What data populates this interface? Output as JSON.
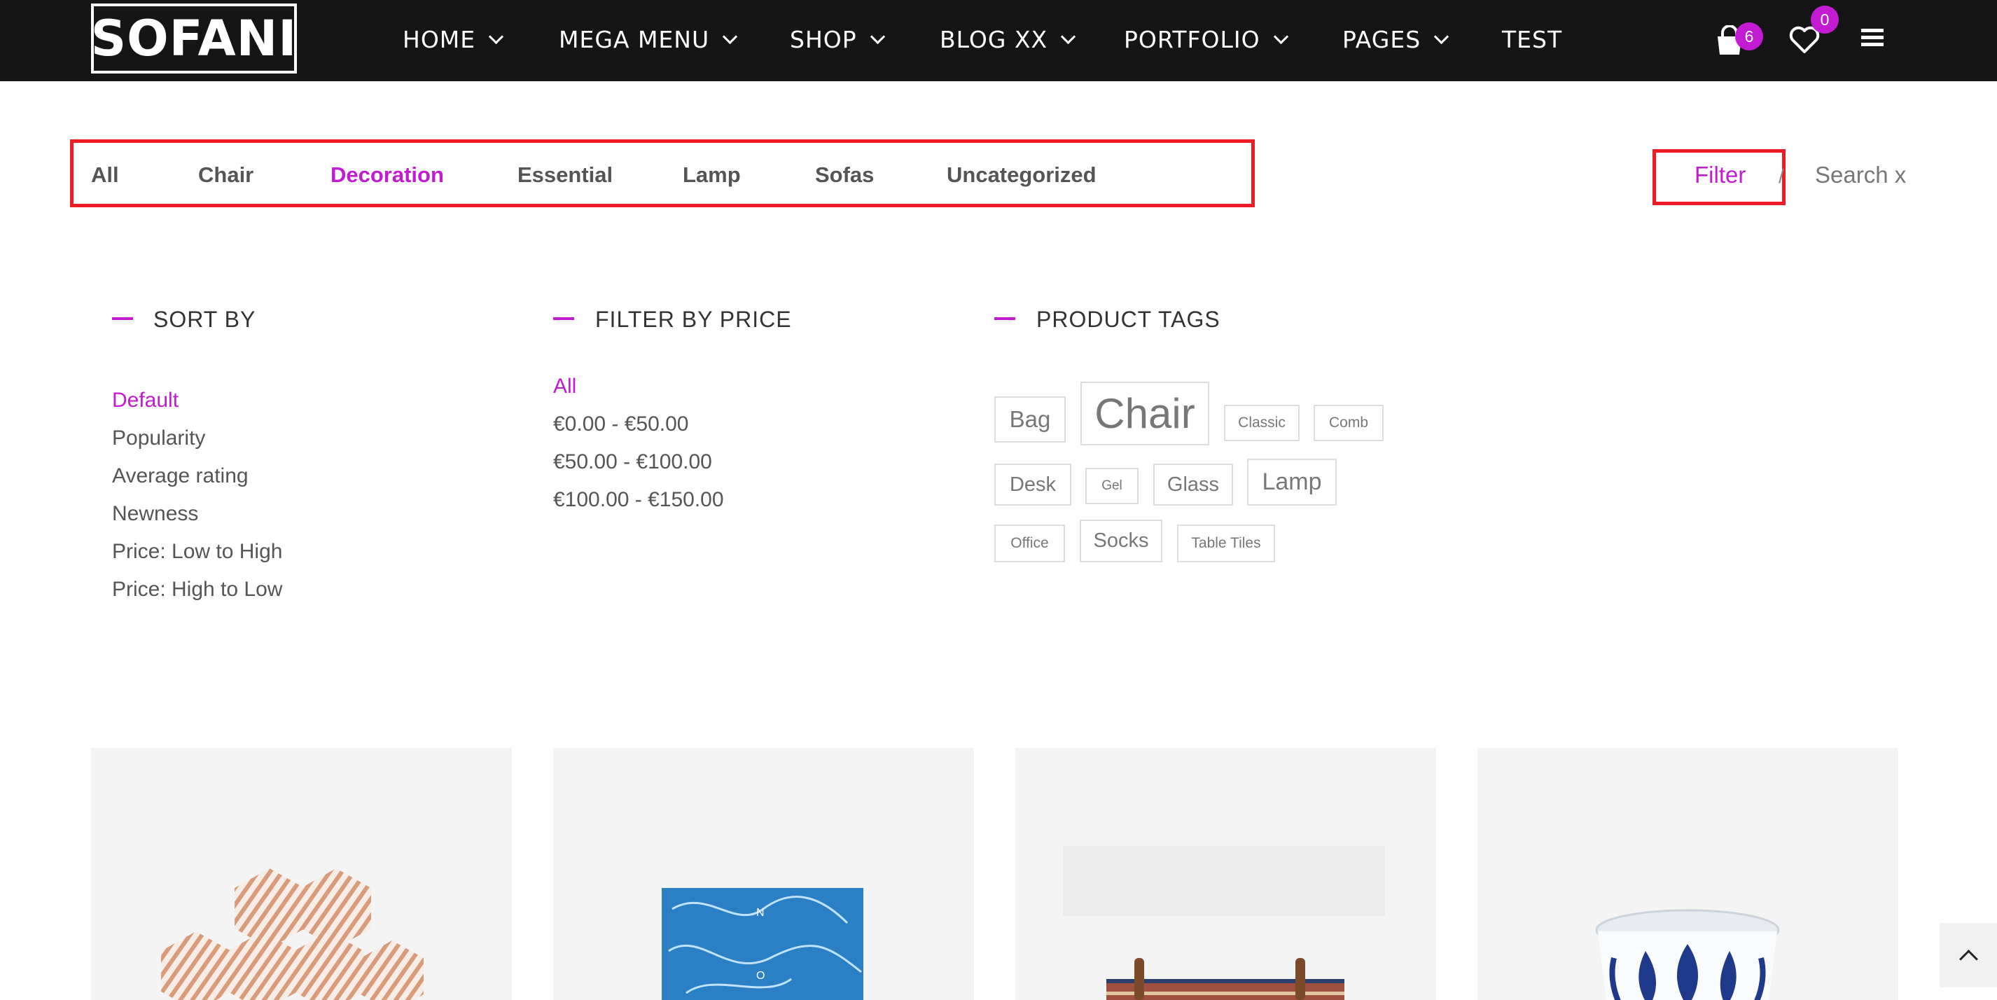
{
  "header": {
    "logo": "SOFANI",
    "nav": [
      {
        "label": "HOME",
        "has_dropdown": true
      },
      {
        "label": "MEGA MENU",
        "has_dropdown": true
      },
      {
        "label": "SHOP",
        "has_dropdown": true
      },
      {
        "label": "BLOG XX",
        "has_dropdown": true
      },
      {
        "label": "PORTFOLIO",
        "has_dropdown": true
      },
      {
        "label": "PAGES",
        "has_dropdown": true
      },
      {
        "label": "TEST",
        "has_dropdown": false
      }
    ],
    "cart_count": "6",
    "wishlist_count": "0",
    "icons": [
      "cart-icon",
      "heart-icon",
      "hamburger-menu-icon"
    ]
  },
  "categories": {
    "items": [
      "All",
      "Chair",
      "Decoration",
      "Essential",
      "Lamp",
      "Sofas",
      "Uncategorized"
    ],
    "active": "Decoration"
  },
  "toolbar": {
    "filter_label": "Filter",
    "separator": "/",
    "search_label": "Search x"
  },
  "filters": {
    "sort_by": {
      "title": "SORT BY",
      "options": [
        "Default",
        "Popularity",
        "Average rating",
        "Newness",
        "Price: Low to High",
        "Price: High to Low"
      ],
      "active": "Default"
    },
    "price": {
      "title": "FILTER BY PRICE",
      "options": [
        "All",
        "€0.00 - €50.00",
        "€50.00 - €100.00",
        "€100.00 - €150.00"
      ],
      "active": "All"
    },
    "tags": {
      "title": "PRODUCT TAGS",
      "items": [
        "Bag",
        "Chair",
        "Classic",
        "Comb",
        "Desk",
        "Gel",
        "Glass",
        "Lamp",
        "Office",
        "Socks",
        "Table Tiles"
      ]
    }
  },
  "colors": {
    "accent": "#c21bd1",
    "header_bg": "#151515",
    "highlight_border": "#ee1c25"
  }
}
